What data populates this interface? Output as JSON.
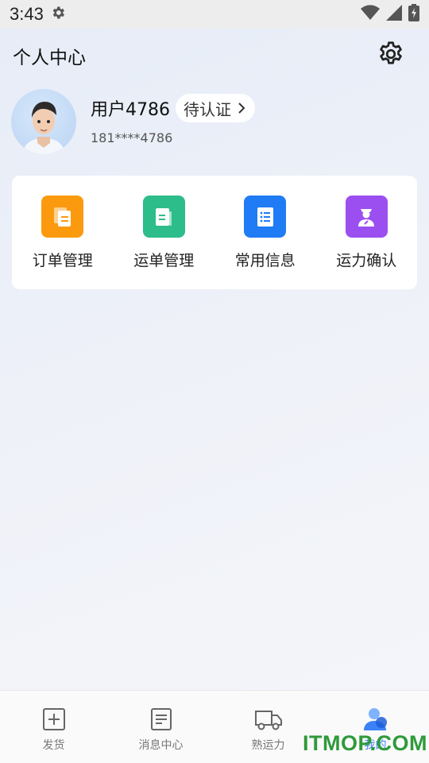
{
  "status_bar": {
    "time": "3:43",
    "icons": [
      "settings-gear-icon",
      "wifi-icon",
      "signal-icon",
      "battery-charging-icon"
    ]
  },
  "header": {
    "title": "个人中心",
    "settings_icon": "gear-icon"
  },
  "profile": {
    "name": "用户4786",
    "verify_label": "待认证",
    "phone": "181****4786"
  },
  "functions": [
    {
      "label": "订单管理",
      "icon": "order-icon",
      "color": "#fb9a0e"
    },
    {
      "label": "运单管理",
      "icon": "waybill-icon",
      "color": "#2dbd8a"
    },
    {
      "label": "常用信息",
      "icon": "info-list-icon",
      "color": "#1f7cf5"
    },
    {
      "label": "运力确认",
      "icon": "driver-icon",
      "color": "#9b4ff0"
    }
  ],
  "tabs": [
    {
      "label": "发货",
      "icon": "plus-square-icon",
      "active": false
    },
    {
      "label": "消息中心",
      "icon": "message-doc-icon",
      "active": false
    },
    {
      "label": "熟运力",
      "icon": "truck-icon",
      "active": false
    },
    {
      "label": "我的",
      "icon": "user-icon",
      "active": true
    }
  ],
  "watermark": "ITMOP.COM",
  "colors": {
    "accent": "#3b82f6",
    "orange": "#fb9a0e",
    "green": "#2dbd8a",
    "blue": "#1f7cf5",
    "purple": "#9b4ff0"
  }
}
